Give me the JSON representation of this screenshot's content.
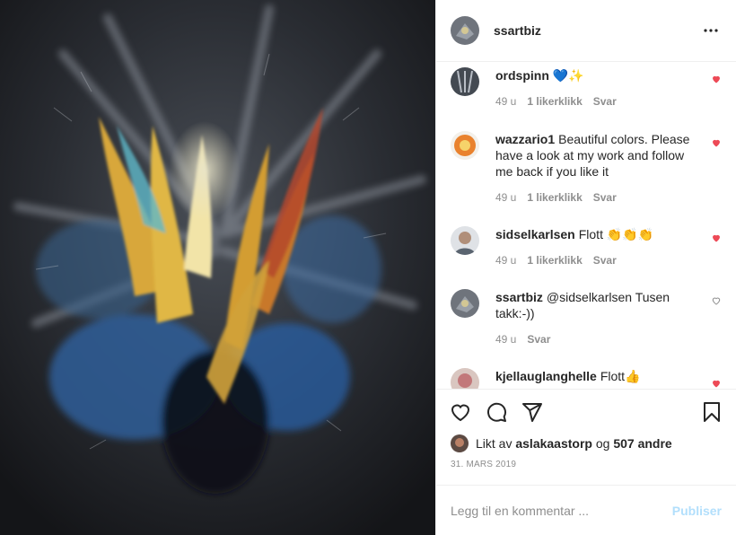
{
  "post": {
    "author": "ssartbiz",
    "more_icon": "more-horizontal-icon",
    "image_alt": "Abstract painting with an explosion of yellow, blue and red textured brush strokes"
  },
  "comments": [
    {
      "user": "ordspinn",
      "text": "💙✨",
      "age": "49 u",
      "likes": "1 likerklikk",
      "reply": "Svar",
      "liked": true
    },
    {
      "user": "wazzario1",
      "text": "Beautiful colors. Please have a look at my work and follow me back if you like it",
      "age": "49 u",
      "likes": "1 likerklikk",
      "reply": "Svar",
      "liked": true
    },
    {
      "user": "sidselkarlsen",
      "text": "Flott 👏👏👏",
      "age": "49 u",
      "likes": "1 likerklikk",
      "reply": "Svar",
      "liked": true
    },
    {
      "user": "ssartbiz",
      "text": "@sidselkarlsen Tusen takk:-))",
      "age": "49 u",
      "likes": "",
      "reply": "Svar",
      "liked": false
    },
    {
      "user": "kjellauglanghelle",
      "text": "Flott👍",
      "age": "",
      "likes": "",
      "reply": "",
      "liked": true
    }
  ],
  "actions": {
    "like_icon": "heart-icon",
    "comment_icon": "comment-icon",
    "share_icon": "share-icon",
    "save_icon": "bookmark-icon"
  },
  "likes_summary": {
    "prefix": "Likt av",
    "user": "aslakaastorp",
    "joiner": "og",
    "others": "507 andre"
  },
  "date": "31. MARS 2019",
  "add_comment": {
    "placeholder": "Legg til en kommentar ...",
    "publish": "Publiser"
  },
  "colors": {
    "like_red": "#ed4956",
    "publish_disabled": "#b2dffc",
    "meta_gray": "#8e8e8e"
  }
}
